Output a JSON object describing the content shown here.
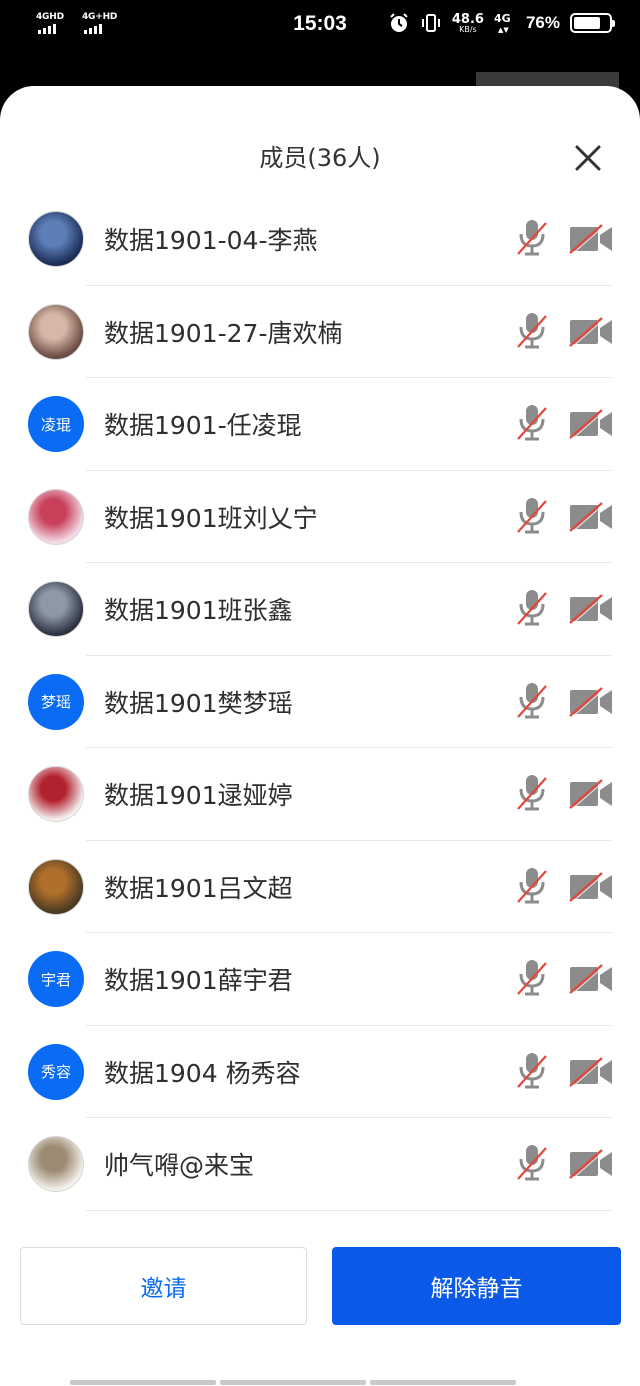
{
  "status_bar": {
    "signal_1": "4GHD",
    "signal_2": "4G+HD",
    "time": "15:03",
    "net_speed": "48.6",
    "net_unit": "KB/s",
    "network": "4G",
    "battery": "76%",
    "battery_level": 0.76
  },
  "sheet": {
    "title": "成员(36人)"
  },
  "members": [
    {
      "name": "数据1901-04-李燕",
      "avatar_type": "image",
      "avatar_colors": [
        "#1b2c55",
        "#5d7fb8"
      ],
      "mic": "muted",
      "camera": "off"
    },
    {
      "name": "数据1901-27-唐欢楠",
      "avatar_type": "image",
      "avatar_colors": [
        "#6a4c45",
        "#d7b8a8"
      ],
      "mic": "muted",
      "camera": "off"
    },
    {
      "name": "数据1901-任凌琨",
      "avatar_type": "text",
      "avatar_text": "凌琨",
      "mic": "muted",
      "camera": "off"
    },
    {
      "name": "数据1901班刘乂宁",
      "avatar_type": "image",
      "avatar_colors": [
        "#f3dbe6",
        "#c8405a"
      ],
      "mic": "muted",
      "camera": "off"
    },
    {
      "name": "数据1901班张鑫",
      "avatar_type": "image",
      "avatar_colors": [
        "#2c3140",
        "#8e99a8"
      ],
      "mic": "muted",
      "camera": "off"
    },
    {
      "name": "数据1901樊梦瑶",
      "avatar_type": "text",
      "avatar_text": "梦瑶",
      "mic": "muted",
      "camera": "off"
    },
    {
      "name": "数据1901逯娅婷",
      "avatar_type": "image",
      "avatar_colors": [
        "#f4eeee",
        "#b2222e"
      ],
      "mic": "muted",
      "camera": "off"
    },
    {
      "name": "数据1901吕文超",
      "avatar_type": "image",
      "avatar_colors": [
        "#4a3a22",
        "#b06f2a"
      ],
      "mic": "muted",
      "camera": "off"
    },
    {
      "name": "数据1901薛宇君",
      "avatar_type": "text",
      "avatar_text": "宇君",
      "mic": "muted",
      "camera": "off"
    },
    {
      "name": "数据1904 杨秀容",
      "avatar_type": "text",
      "avatar_text": "秀容",
      "mic": "muted",
      "camera": "off"
    },
    {
      "name": "帅气嘚@来宝",
      "avatar_type": "image",
      "avatar_colors": [
        "#f3f0ea",
        "#9c8a72"
      ],
      "mic": "muted",
      "camera": "off"
    }
  ],
  "buttons": {
    "invite": "邀请",
    "unmute_all": "解除静音"
  },
  "colors": {
    "accent": "#0a59e8",
    "avatar_bg": "#0a6bf5",
    "muted_slash": "#e0483c",
    "icon_gray": "#8c8c8c"
  }
}
